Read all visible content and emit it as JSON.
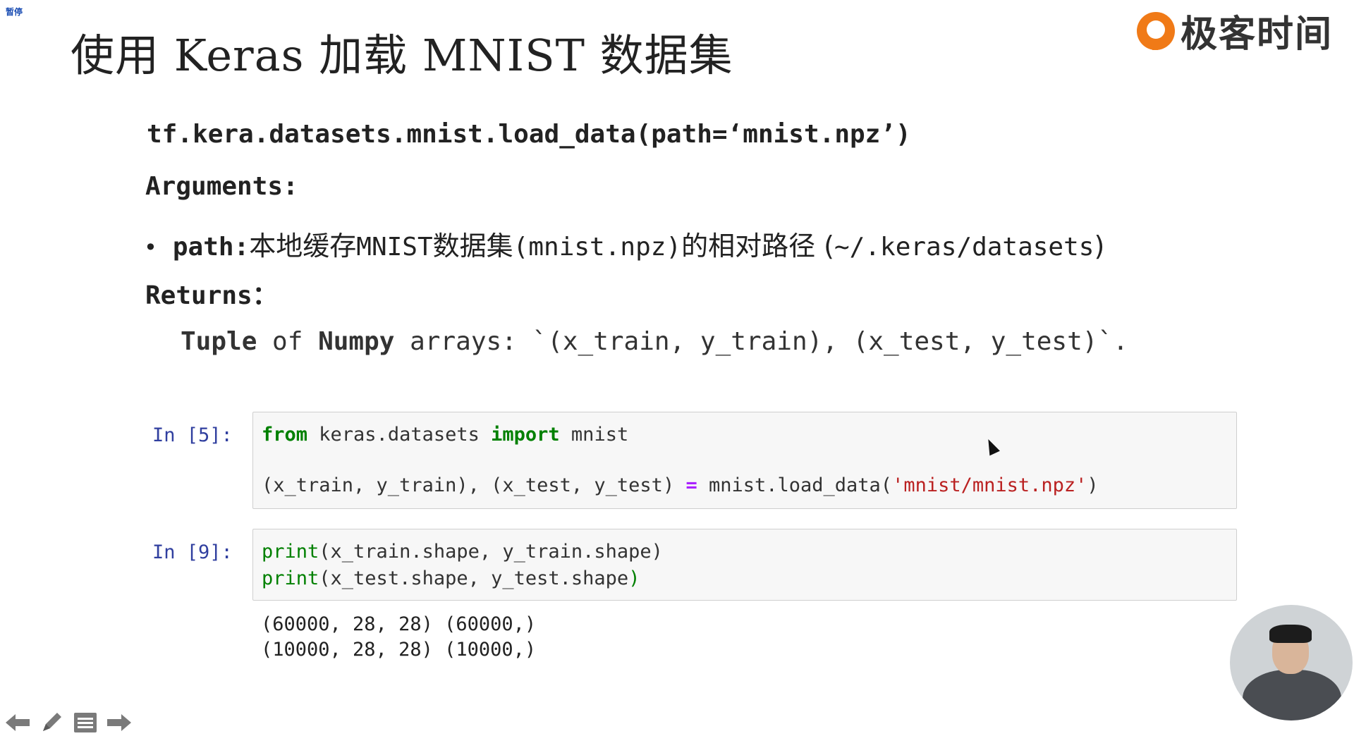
{
  "pause_label": "暂停",
  "title": "使用 Keras 加载 MNIST 数据集",
  "logo": {
    "text": "极客时间",
    "color": "#f07a17"
  },
  "doc": {
    "signature": "tf.kera.datasets.mnist.load_data(path=‘mnist.npz’)",
    "arguments_label": "Arguments:",
    "bullet": "•",
    "param_name": "path",
    "param_sep": ":",
    "param_desc_1": "本地缓存 ",
    "param_mono_1": "MNIST",
    "param_desc_2": " 数据集",
    "param_mono_2": "(mnist.npz)",
    "param_desc_3": "的相对路径 ( ",
    "param_mono_3": "~/.keras/datasets",
    "param_desc_4": " )",
    "returns_label": "Returns：",
    "returns_b1": "Tuple",
    "returns_t1": " of ",
    "returns_b2": "Numpy",
    "returns_t2": " arrays: `(x_train, y_train), (x_test, y_test)`."
  },
  "cells": [
    {
      "prompt": "In [5]:",
      "line1": {
        "kw1": "from",
        "t1": " keras.datasets ",
        "kw2": "import",
        "t2": " mnist"
      },
      "line2": {
        "t1": "(x_train, y_train), (x_test, y_test) ",
        "op": "=",
        "t2": " mnist.load_data(",
        "str": "'mnist/mnist.npz'",
        "t3": ")"
      }
    },
    {
      "prompt": "In [9]:",
      "line1": {
        "fn": "print",
        "t": "(x_train.shape, y_train.shape)"
      },
      "line2": {
        "fn": "print",
        "t": "(x_test.shape, y_test.shape",
        "fn_close": ")"
      },
      "output": [
        "(60000, 28, 28) (60000,)",
        "(10000, 28, 28) (10000,)"
      ]
    }
  ],
  "nav_icons": [
    "arrow-left-icon",
    "pencil-icon",
    "menu-icon",
    "arrow-right-icon"
  ]
}
